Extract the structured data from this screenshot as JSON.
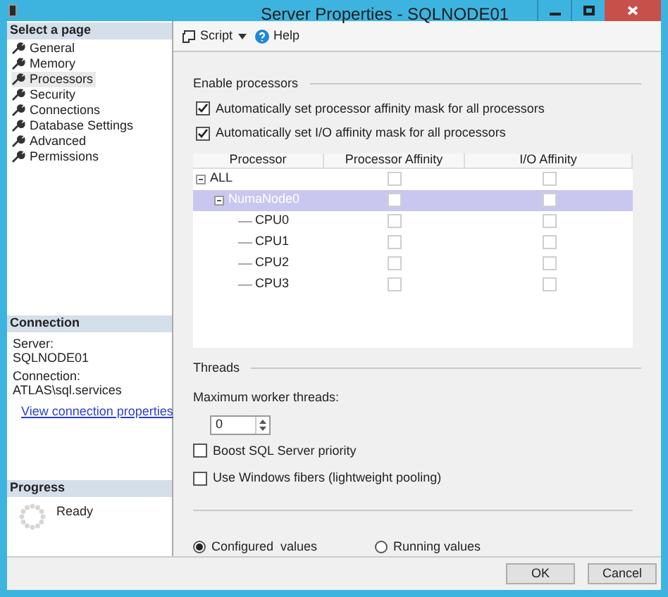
{
  "window": {
    "title": "Server Properties - SQLNODE01"
  },
  "sidebar": {
    "header": "Select a page",
    "items": [
      {
        "label": "General",
        "selected": false
      },
      {
        "label": "Memory",
        "selected": false
      },
      {
        "label": "Processors",
        "selected": true
      },
      {
        "label": "Security",
        "selected": false
      },
      {
        "label": "Connections",
        "selected": false
      },
      {
        "label": "Database Settings",
        "selected": false
      },
      {
        "label": "Advanced",
        "selected": false
      },
      {
        "label": "Permissions",
        "selected": false
      }
    ]
  },
  "connection": {
    "header": "Connection",
    "server_label": "Server:",
    "server": "SQLNODE01",
    "connection_label": "Connection:",
    "connection": "ATLAS\\sql.services",
    "link": "View connection properties"
  },
  "progress": {
    "header": "Progress",
    "status": "Ready"
  },
  "toolbar": {
    "script": "Script",
    "help": "Help"
  },
  "enable_processors": {
    "title": "Enable processors",
    "options": [
      {
        "label": "Automatically set processor affinity mask for all processors",
        "checked": true
      },
      {
        "label": "Automatically set I/O affinity mask for all processors",
        "checked": true
      }
    ]
  },
  "grid": {
    "columns": [
      "Processor",
      "Processor Affinity",
      "I/O Affinity"
    ],
    "disabled": true,
    "rows": [
      {
        "name": "ALL",
        "processor_affinity": false,
        "io_affinity": false,
        "selected": false,
        "expanded": true,
        "children": [
          {
            "name": "NumaNode0",
            "processor_affinity": false,
            "io_affinity": false,
            "selected": true,
            "expanded": true,
            "children": [
              {
                "name": "CPU0",
                "processor_affinity": false,
                "io_affinity": false,
                "selected": false
              },
              {
                "name": "CPU1",
                "processor_affinity": false,
                "io_affinity": false,
                "selected": false
              },
              {
                "name": "CPU2",
                "processor_affinity": false,
                "io_affinity": false,
                "selected": false
              },
              {
                "name": "CPU3",
                "processor_affinity": false,
                "io_affinity": false,
                "selected": false
              }
            ]
          }
        ]
      }
    ]
  },
  "threads": {
    "title": "Threads",
    "max_label": "Maximum worker threads:",
    "max_value": "0",
    "options": [
      {
        "label": "Boost SQL Server priority",
        "checked": false
      },
      {
        "label": "Use Windows fibers (lightweight pooling)",
        "checked": false
      }
    ]
  },
  "values": [
    {
      "label": "Configured  values",
      "selected": true
    },
    {
      "label": "Running values",
      "selected": false
    }
  ],
  "buttons": [
    "OK",
    "Cancel"
  ]
}
